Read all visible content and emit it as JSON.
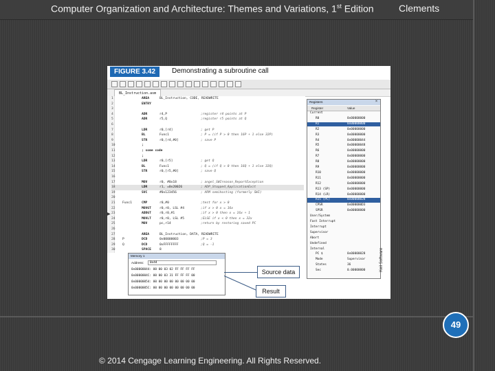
{
  "header": {
    "book_title": "Computer Organization and Architecture: Themes and Variations, 1",
    "book_title_sup": "st",
    "book_title_end": " Edition",
    "author": "Clements"
  },
  "figure": {
    "label": "FIGURE 3.42",
    "caption": "Demonstrating a subroutine call",
    "file_tab": "BL_Instruction.asm",
    "vertical_credit": "Keil Software"
  },
  "code": [
    {
      "num": "1",
      "label": "",
      "op": "AREA",
      "arg": "BL_Instruction, CODE, READWRITE",
      "cmt": ""
    },
    {
      "num": "2",
      "label": "",
      "op": "ENTRY",
      "arg": "",
      "cmt": ""
    },
    {
      "num": "3",
      "label": "",
      "op": "",
      "arg": "",
      "cmt": ""
    },
    {
      "num": "4",
      "label": "",
      "op": "ADR",
      "arg": "r4,P",
      "cmt": ";register r4 points at P"
    },
    {
      "num": "5",
      "label": "",
      "op": "ADR",
      "arg": "r5,Q",
      "cmt": ";register r5 points at Q"
    },
    {
      "num": "6",
      "label": "",
      "op": "",
      "arg": "",
      "cmt": ""
    },
    {
      "num": "7",
      "label": "",
      "op": "LDR",
      "arg": "r0,[r4]",
      "cmt": "; get P"
    },
    {
      "num": "8",
      "label": "",
      "op": "BL",
      "arg": "Func1",
      "cmt": "; P = (if P > 0 then 16P + 1 else 32P)"
    },
    {
      "num": "9",
      "label": "",
      "op": "STR",
      "arg": "r0,[r4,#0]",
      "cmt": "; save P"
    },
    {
      "num": "10",
      "label": "",
      "op": ";",
      "arg": "",
      "cmt": ""
    },
    {
      "num": "11",
      "label": "",
      "op": "; some code",
      "arg": "",
      "cmt": ""
    },
    {
      "num": "12",
      "label": "",
      "op": ";",
      "arg": "",
      "cmt": ""
    },
    {
      "num": "13",
      "label": "",
      "op": "LDR",
      "arg": "r0,[r5]",
      "cmt": "; get Q"
    },
    {
      "num": "14",
      "label": "",
      "op": "BL",
      "arg": "Func1",
      "cmt": "; Q = (if Q > 0 then 16Q + 1 else 32Q)"
    },
    {
      "num": "15",
      "label": "",
      "op": "STR",
      "arg": "r0,[r5,#0]",
      "cmt": "; save Q"
    },
    {
      "num": "16",
      "label": "",
      "op": "",
      "arg": "",
      "cmt": ""
    },
    {
      "num": "17",
      "label": "",
      "op": "MOV",
      "arg": "r0, #0x18",
      "cmt": "; angel_SWIreason_ReportException"
    },
    {
      "num": "18",
      "label": "",
      "op": "LDR",
      "arg": "r1, =0x20026",
      "cmt": "; ADP_Stopped_ApplicationExit"
    },
    {
      "num": "19",
      "label": "",
      "op": "SVC",
      "arg": "#0x123456",
      "cmt": "; ARM semihosting (formerly SWI)"
    },
    {
      "num": "20",
      "label": "",
      "op": "",
      "arg": "",
      "cmt": ""
    },
    {
      "num": "21",
      "label": "Func1",
      "op": "CMP",
      "arg": "r0,#0",
      "cmt": ";test for x > 0"
    },
    {
      "num": "22",
      "label": "",
      "op": "MOVGT",
      "arg": "r0,r0, LSL #4",
      "cmt": ";if x > 0 x = 16x"
    },
    {
      "num": "23",
      "label": "",
      "op": "ADDGT",
      "arg": "r0,r0,#1",
      "cmt": ";if x > 0 then x = 16x + 1"
    },
    {
      "num": "24",
      "label": "",
      "op": "MOVLT",
      "arg": "r0,r0, LSL #5",
      "cmt": ";ELSE if x < 0 then x = 32x"
    },
    {
      "num": "25",
      "label": "",
      "op": "MOV",
      "arg": "pc,r14",
      "cmt": ";return by restoring saved PC"
    },
    {
      "num": "26",
      "label": "",
      "op": "",
      "arg": "",
      "cmt": ""
    },
    {
      "num": "27",
      "label": "",
      "op": "AREA",
      "arg": "BL_Instruction, DATA, READWRITE",
      "cmt": ""
    },
    {
      "num": "28",
      "label": "P",
      "op": "DCD",
      "arg": "0x00000003",
      "cmt": ";P = 3"
    },
    {
      "num": "29",
      "label": "Q",
      "op": "DCD",
      "arg": "0xFFFFFFFF",
      "cmt": ";Q = -1"
    },
    {
      "num": "30",
      "label": "",
      "op": "SPACE",
      "arg": "8",
      "cmt": ""
    }
  ],
  "registers": {
    "title": "Registers",
    "col_register": "Register",
    "col_value": "Value",
    "rows": [
      {
        "name": "Current",
        "value": "",
        "indent": 0
      },
      {
        "name": "R0",
        "value": "0x00000000",
        "indent": 1
      },
      {
        "name": "R1",
        "value": "0x00000000",
        "indent": 1
      },
      {
        "name": "R2",
        "value": "0x00000000",
        "indent": 1
      },
      {
        "name": "R3",
        "value": "0x00000000",
        "indent": 1
      },
      {
        "name": "R4",
        "value": "0x00000044",
        "indent": 1
      },
      {
        "name": "R5",
        "value": "0x00000048",
        "indent": 1
      },
      {
        "name": "R6",
        "value": "0x00000000",
        "indent": 1
      },
      {
        "name": "R7",
        "value": "0x00000000",
        "indent": 1
      },
      {
        "name": "R8",
        "value": "0x00000000",
        "indent": 1
      },
      {
        "name": "R9",
        "value": "0x00000000",
        "indent": 1
      },
      {
        "name": "R10",
        "value": "0x00000000",
        "indent": 1
      },
      {
        "name": "R11",
        "value": "0x00000000",
        "indent": 1
      },
      {
        "name": "R12",
        "value": "0x00000000",
        "indent": 1
      },
      {
        "name": "R13 (SP)",
        "value": "0x00000000",
        "indent": 1
      },
      {
        "name": "R14 (LR)",
        "value": "0x00000000",
        "indent": 1
      },
      {
        "name": "R15 (PC)",
        "value": "0x00000028",
        "indent": 1
      },
      {
        "name": "CPSR",
        "value": "0x000000D3",
        "indent": 1
      },
      {
        "name": "SPSR",
        "value": "0x00000000",
        "indent": 1
      },
      {
        "name": "User/System",
        "value": "",
        "indent": 0
      },
      {
        "name": "Fast Interrupt",
        "value": "",
        "indent": 0
      },
      {
        "name": "Interrupt",
        "value": "",
        "indent": 0
      },
      {
        "name": "Supervisor",
        "value": "",
        "indent": 0
      },
      {
        "name": "Abort",
        "value": "",
        "indent": 0
      },
      {
        "name": "Undefined",
        "value": "",
        "indent": 0
      },
      {
        "name": "Internal",
        "value": "",
        "indent": 0
      },
      {
        "name": "PC $",
        "value": "0x00000028",
        "indent": 1
      },
      {
        "name": "Mode",
        "value": "Supervisor",
        "indent": 1
      },
      {
        "name": "States",
        "value": "36",
        "indent": 1
      },
      {
        "name": "Sec",
        "value": "0.00000000",
        "indent": 1
      }
    ],
    "selected_index": 2,
    "pc_index": 16
  },
  "memory": {
    "title": "Memory 1",
    "address_label": "Address:",
    "address_value": "0x44",
    "rows": [
      "0x00000044: 00 00 03 02 FF FF FF FF",
      "0x0000004C: 00 00 03 31 FF FF FF 00",
      "0x00000054: 00 00 00 00 00 00 00 00",
      "0x0000005C: 00 00 00 00 00 00 00 00"
    ]
  },
  "callouts": {
    "source": "Source data",
    "result": "Result"
  },
  "footer": {
    "page_number": "49",
    "copyright": "© 2014 Cengage Learning Engineering. All Rights Reserved."
  }
}
